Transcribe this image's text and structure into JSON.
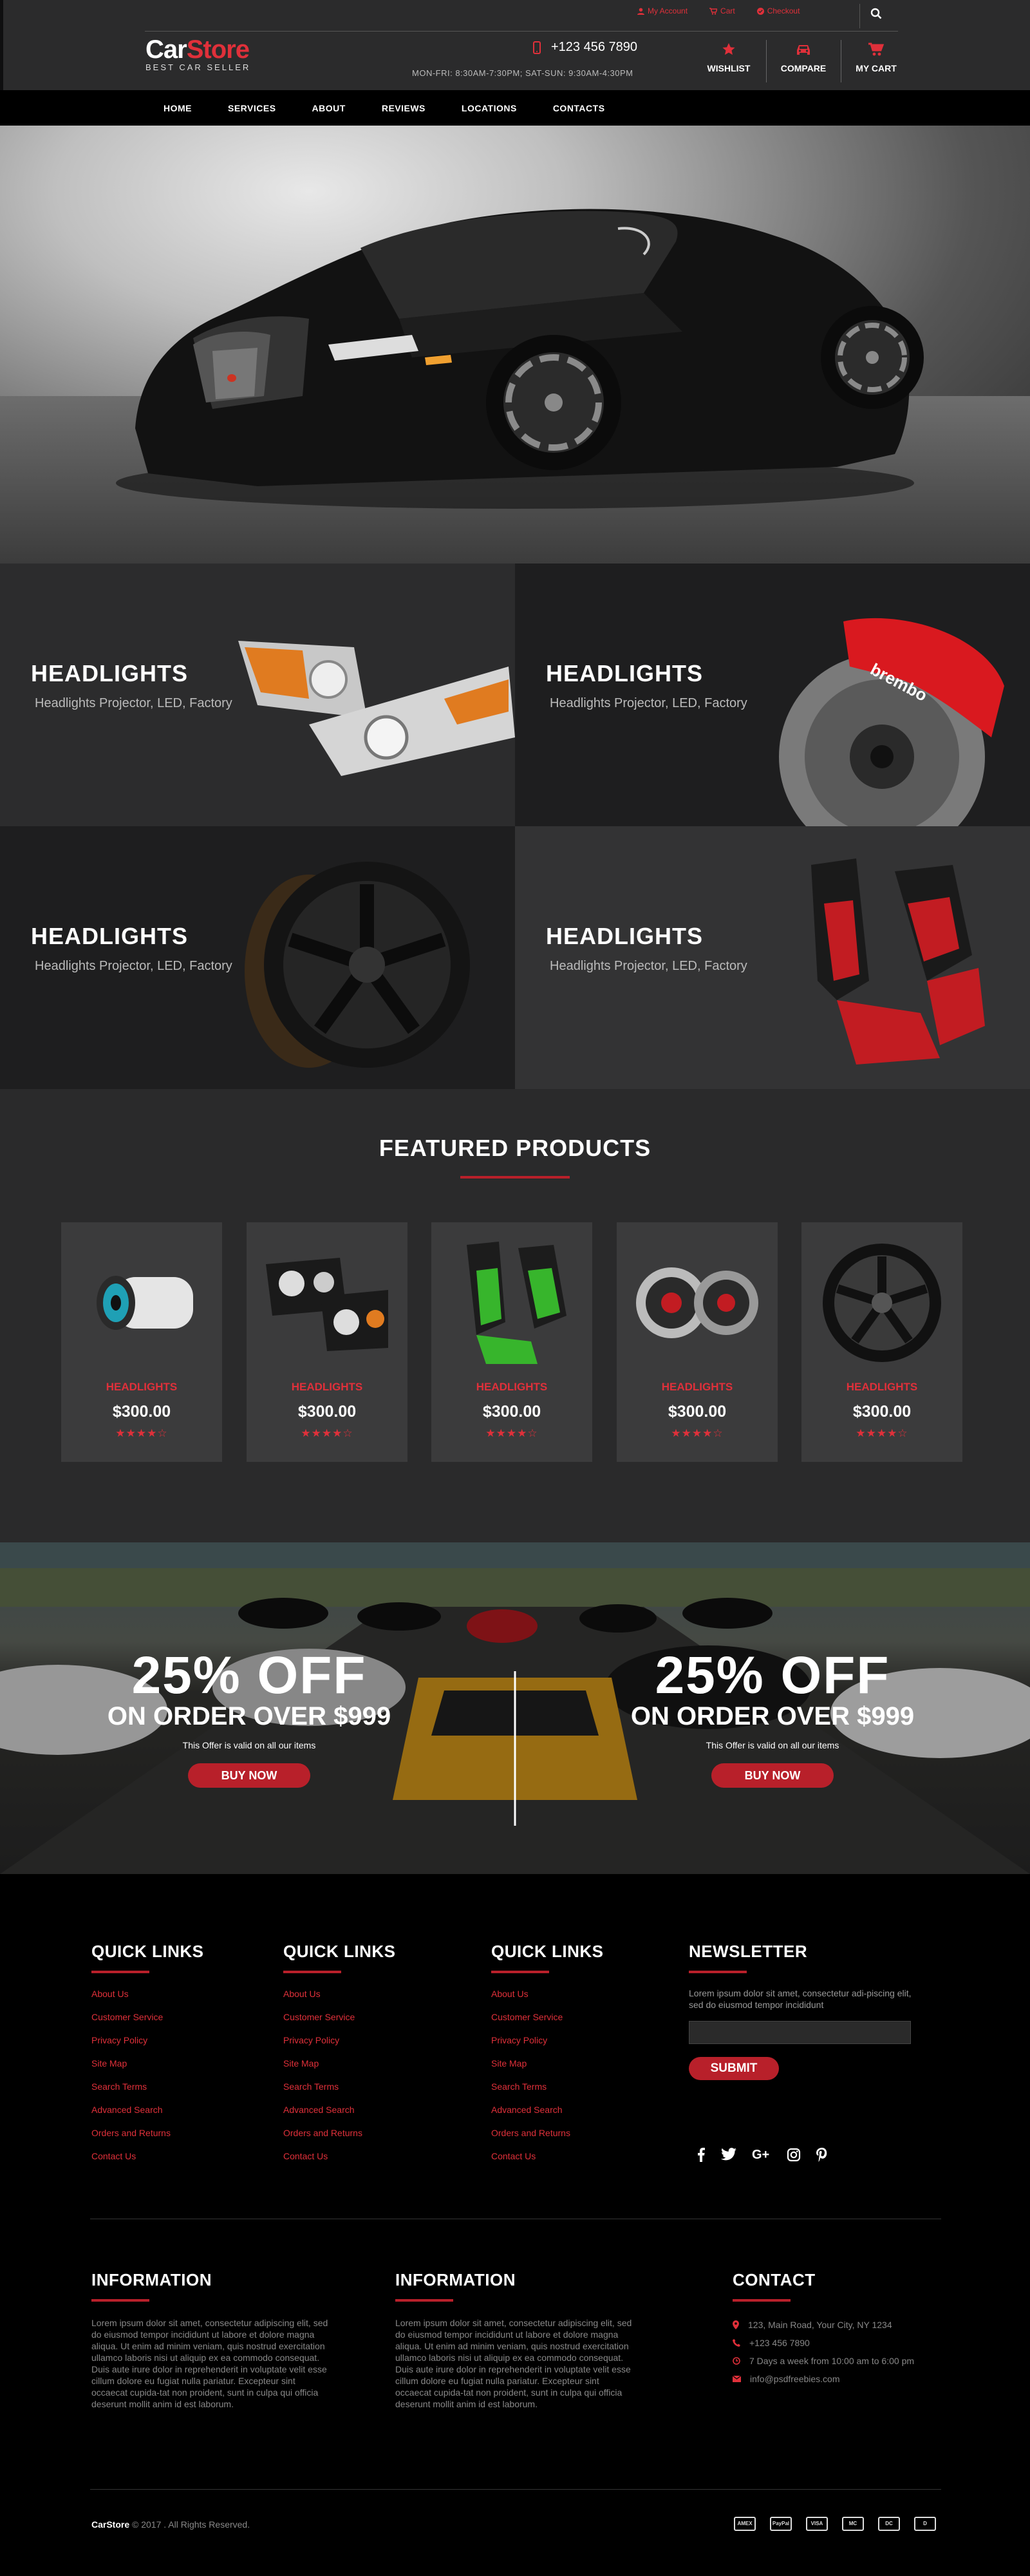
{
  "header": {
    "top_links": [
      "My Account",
      "Cart",
      "Checkout"
    ],
    "logo_part1": "Car",
    "logo_part2": "Store",
    "tagline": "BEST CAR SELLER",
    "phone": "+123 456 7890",
    "hours": "MON-FRI: 8:30AM-7:30PM; SAT-SUN: 9:30AM-4:30PM",
    "actions": [
      "WISHLIST",
      "COMPARE",
      "MY CART"
    ]
  },
  "nav": [
    "HOME",
    "SERVICES",
    "ABOUT",
    "REVIEWS",
    "LOCATIONS",
    "CONTACTS"
  ],
  "categories": [
    {
      "title": "HEADLIGHTS",
      "subtitle": "Headlights Projector, LED, Factory"
    },
    {
      "title": "HEADLIGHTS",
      "subtitle": "Headlights Projector, LED, Factory"
    },
    {
      "title": "HEADLIGHTS",
      "subtitle": "Headlights Projector, LED, Factory"
    },
    {
      "title": "HEADLIGHTS",
      "subtitle": "Headlights Projector, LED, Factory"
    }
  ],
  "brembo_label": "brembo",
  "featured": {
    "title": "FEATURED PRODUCTS",
    "products": [
      {
        "name": "HEADLIGHTS",
        "price": "$300.00",
        "stars": "★★★★☆"
      },
      {
        "name": "HEADLIGHTS",
        "price": "$300.00",
        "stars": "★★★★☆"
      },
      {
        "name": "HEADLIGHTS",
        "price": "$300.00",
        "stars": "★★★★☆"
      },
      {
        "name": "HEADLIGHTS",
        "price": "$300.00",
        "stars": "★★★★☆"
      },
      {
        "name": "HEADLIGHTS",
        "price": "$300.00",
        "stars": "★★★★☆"
      }
    ]
  },
  "promo": [
    {
      "discount": "25% OFF",
      "condition": "ON ORDER OVER $999",
      "note": "This Offer is valid on all our items",
      "button": "BUY NOW"
    },
    {
      "discount": "25% OFF",
      "condition": "ON ORDER OVER $999",
      "note": "This Offer is valid on all our items",
      "button": "BUY NOW"
    }
  ],
  "footer": {
    "quick_links": [
      {
        "title": "QUICK LINKS",
        "links": [
          "About Us",
          "Customer Service",
          "Privacy Policy",
          "Site Map",
          "Search Terms",
          "Advanced Search",
          "Orders and Returns",
          "Contact Us"
        ]
      },
      {
        "title": "QUICK LINKS",
        "links": [
          "About Us",
          "Customer Service",
          "Privacy Policy",
          "Site Map",
          "Search Terms",
          "Advanced Search",
          "Orders and Returns",
          "Contact Us"
        ]
      },
      {
        "title": "QUICK LINKS",
        "links": [
          "About Us",
          "Customer Service",
          "Privacy Policy",
          "Site Map",
          "Search Terms",
          "Advanced Search",
          "Orders and Returns",
          "Contact Us"
        ]
      }
    ],
    "newsletter": {
      "title": "NEWSLETTER",
      "text": "Lorem ipsum dolor sit amet, consectetur adi-piscing elit, sed do eiusmod tempor incididunt",
      "button": "SUBMIT"
    },
    "info": [
      {
        "title": "INFORMATION",
        "text": "Lorem ipsum dolor sit amet, consectetur adipiscing elit, sed do eiusmod tempor incididunt ut labore et dolore magna aliqua. Ut enim ad minim veniam, quis nostrud exercitation ullamco laboris nisi ut aliquip ex ea commodo consequat. Duis aute irure dolor in reprehenderit in voluptate velit esse cillum dolore eu fugiat nulla pariatur. Excepteur sint occaecat cupida-tat non proident, sunt in culpa qui officia deserunt mollit anim id est laborum."
      },
      {
        "title": "INFORMATION",
        "text": "Lorem ipsum dolor sit amet, consectetur adipiscing elit, sed do eiusmod tempor incididunt ut labore et dolore magna aliqua. Ut enim ad minim veniam, quis nostrud exercitation ullamco laboris nisi ut aliquip ex ea commodo consequat. Duis aute irure dolor in reprehenderit in voluptate velit esse cillum dolore eu fugiat nulla pariatur. Excepteur sint occaecat cupida-tat non proident, sunt in culpa qui officia deserunt mollit anim id est laborum."
      }
    ],
    "contact": {
      "title": "CONTACT",
      "address": "123, Main Road, Your City, NY 1234",
      "phone": "+123 456 7890",
      "hours": "7 Days a week from 10:00 am to 6:00 pm",
      "email": "info@psdfreebies.com"
    },
    "copyright_brand": "CarStore",
    "copyright_text": " © 2017 . All Rights Reserved.",
    "payment_icons": [
      "AMEX",
      "PayPal",
      "VISA",
      "MC",
      "DC",
      "D"
    ]
  },
  "colors": {
    "accent": "#e0303a",
    "button": "#b8202a",
    "background": "#2a2a2b",
    "footer": "#000000"
  }
}
